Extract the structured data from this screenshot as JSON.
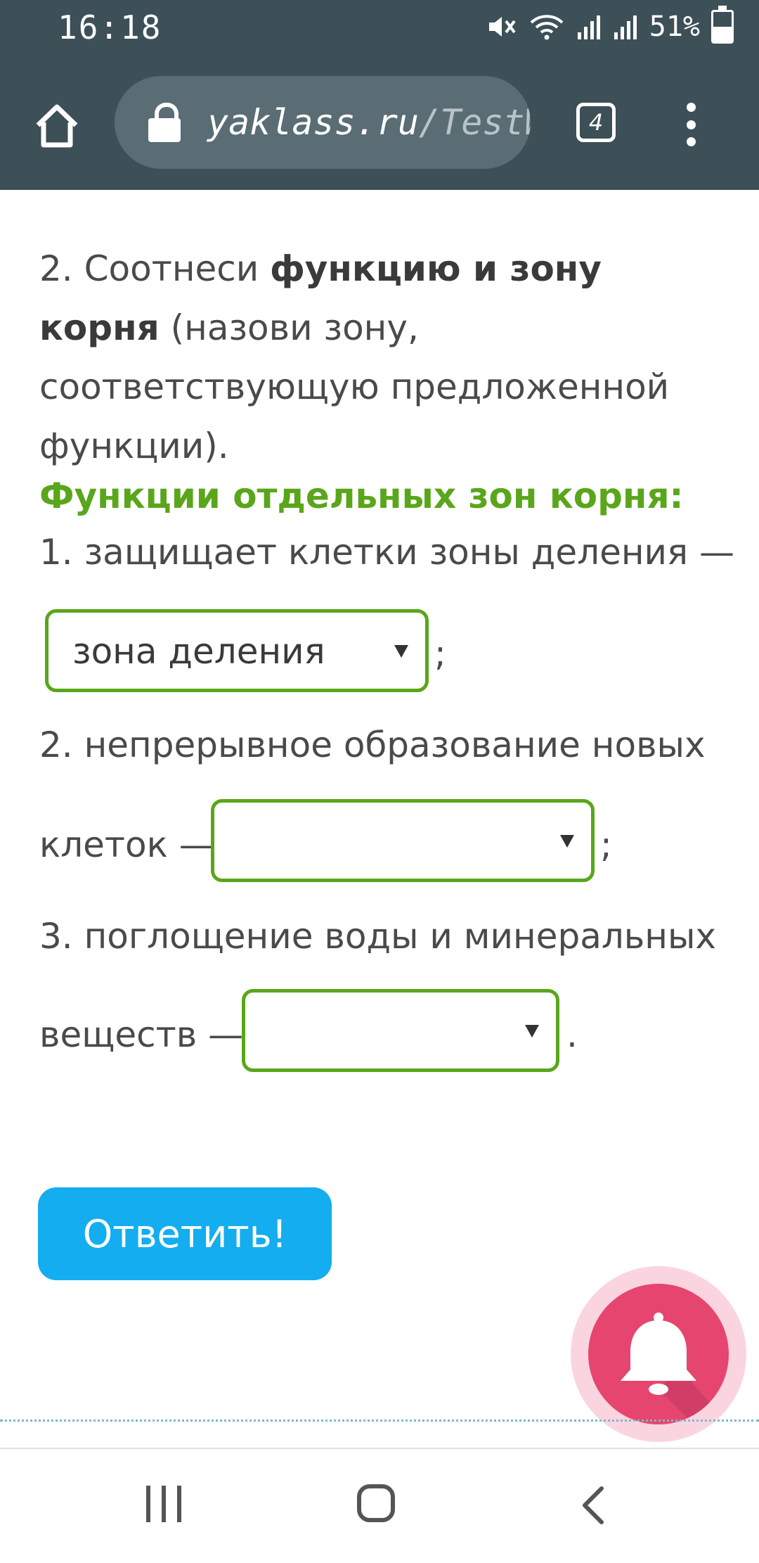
{
  "status_bar": {
    "time": "16:18",
    "battery": "51%"
  },
  "browser": {
    "url_host": "yaklass.ru",
    "url_path": "/TestW",
    "tab_count": "4"
  },
  "question": {
    "number": "2.",
    "text_before": " Соотнеси ",
    "bold": "функцию и зону корня",
    "text_after": " (назови зону, соответствующую предложенной функции)."
  },
  "section_title": "Функции отдельных зон корня:",
  "items": [
    {
      "line1": "1. защищает клетки зоны деления —",
      "selected": "зона деления",
      "end": ";"
    },
    {
      "line1": "2. непрерывное образование новых",
      "line2": "клеток —",
      "selected": "",
      "end": ";"
    },
    {
      "line1": "3. поглощение воды и минеральных",
      "line2": "веществ —",
      "selected": "",
      "end": "."
    }
  ],
  "answer_button": "Ответить!",
  "colors": {
    "topbar": "#3d4f57",
    "accent_green": "#5aa61b",
    "button_blue": "#13adf0",
    "bell": "#e6456f"
  }
}
